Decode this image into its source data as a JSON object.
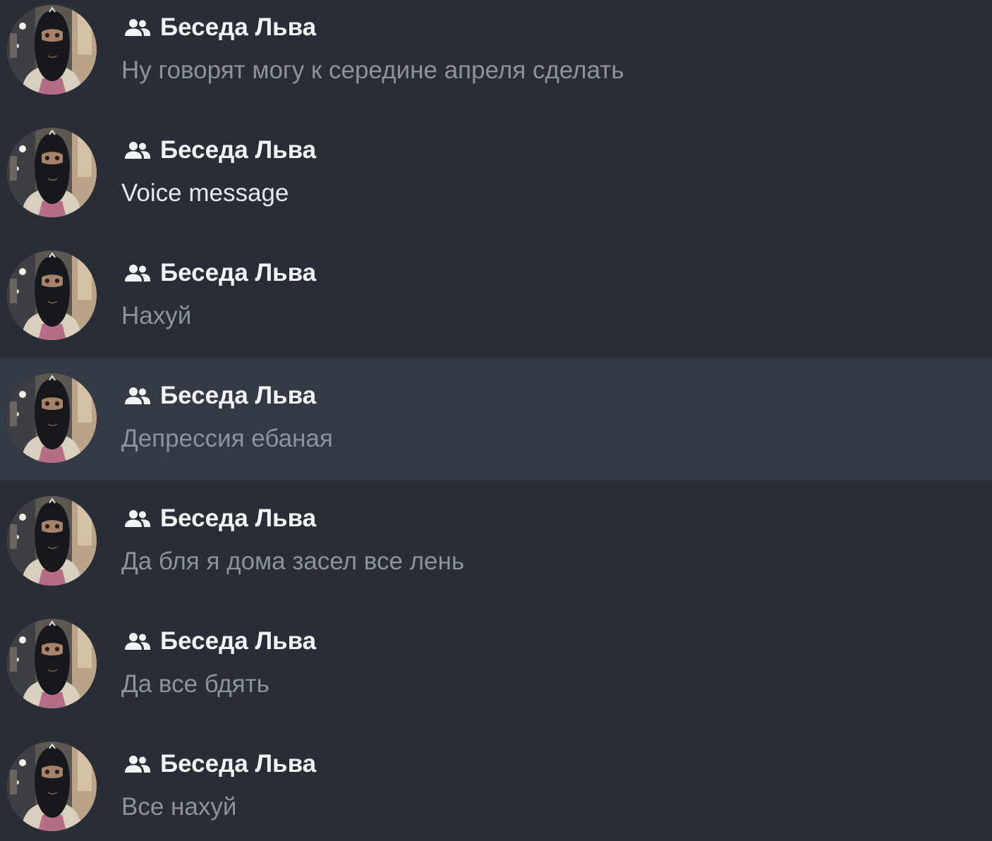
{
  "colors": {
    "background": "#292d35",
    "selected_background": "#343a43",
    "title": "#f2f3f5",
    "preview": "#8c939c",
    "media_preview": "#e6e8eb"
  },
  "icons": {
    "group": "group-icon",
    "avatar": "user-avatar-photo"
  },
  "chats": [
    {
      "title": "Беседа Льва",
      "preview": "Ну говорят могу к середине апреля сделать",
      "selected": false,
      "media": false
    },
    {
      "title": "Беседа Льва",
      "preview": "Voice message",
      "selected": false,
      "media": true
    },
    {
      "title": "Беседа Льва",
      "preview": "Нахуй",
      "selected": false,
      "media": false
    },
    {
      "title": "Беседа Льва",
      "preview": "Депрессия ебаная",
      "selected": true,
      "media": false
    },
    {
      "title": "Беседа Льва",
      "preview": "Да бля я дома засел все лень",
      "selected": false,
      "media": false
    },
    {
      "title": "Беседа Льва",
      "preview": "Да все бдять",
      "selected": false,
      "media": false
    },
    {
      "title": "Беседа Льва",
      "preview": "Все нахуй",
      "selected": false,
      "media": false
    }
  ]
}
